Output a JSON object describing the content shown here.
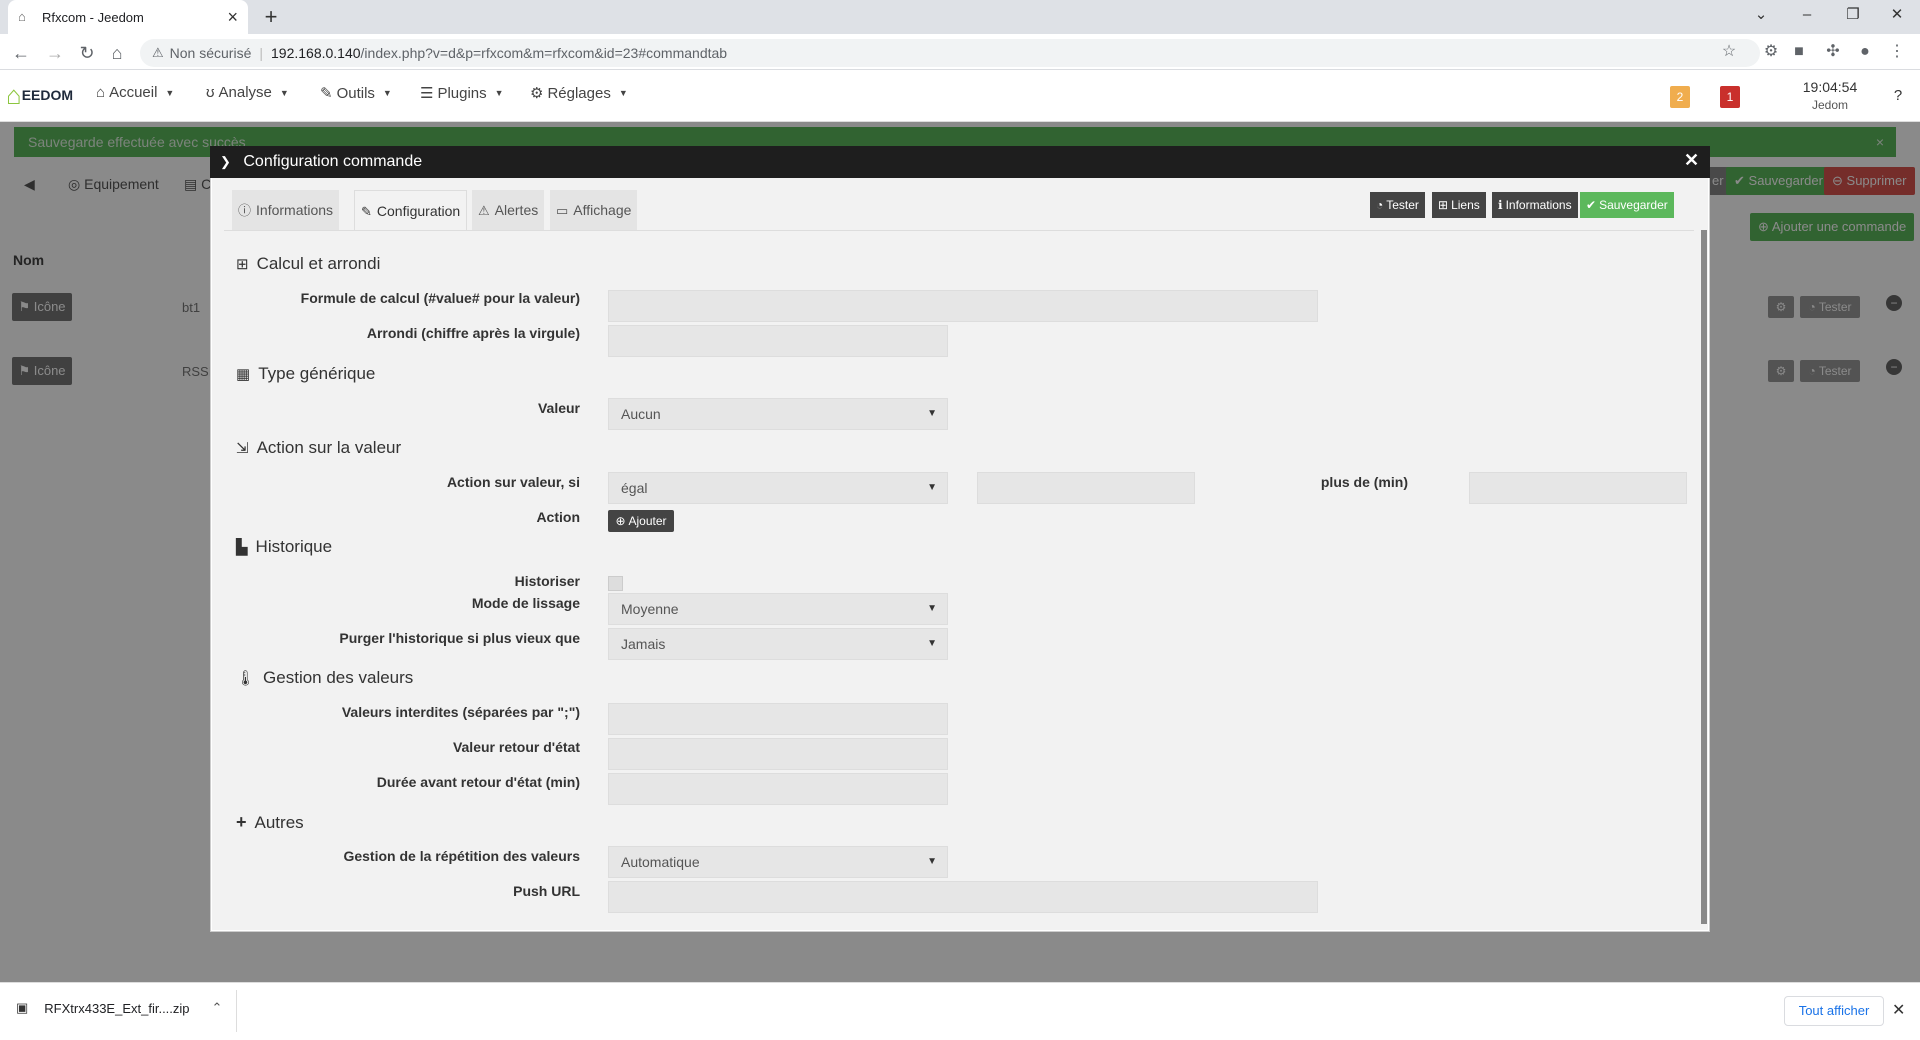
{
  "browser": {
    "tab_title": "Rfxcom - Jeedom",
    "security_label": "Non sécurisé",
    "url_host": "192.168.0.140",
    "url_path": "/index.php?v=d&p=rfxcom&m=rfxcom&id=23#commandtab"
  },
  "navbar": {
    "logo_text": "EEDOM",
    "menu": [
      "Accueil",
      "Analyse",
      "Outils",
      "Plugins",
      "Réglages"
    ],
    "badge_warning": "2",
    "badge_danger": "1",
    "clock_time": "19:04:54",
    "clock_user": "Jedom",
    "colors": {
      "warning": "#f0ad4e",
      "danger": "#c9302c"
    }
  },
  "page": {
    "alert_text": "Sauvegarde effectuée avec succès",
    "tabs": [
      "Equipement",
      "C"
    ],
    "btn_sauvegarder": "Sauvegarder",
    "btn_supprimer": "Supprimer",
    "btn_partial": "er",
    "btn_ajouter_commande": "Ajouter une commande",
    "nom_header": "Nom",
    "rows": [
      {
        "icone": "Icône",
        "name": "bt1",
        "tester": "Tester"
      },
      {
        "icone": "Icône",
        "name": "RSSI",
        "tester": "Tester"
      }
    ]
  },
  "modal": {
    "title": "Configuration commande",
    "tabs": [
      "Informations",
      "Configuration",
      "Alertes",
      "Affichage"
    ],
    "toolbar": {
      "tester": "Tester",
      "liens": "Liens",
      "informations": "Informations",
      "sauvegarder": "Sauvegarder"
    },
    "sections": {
      "calcul": {
        "title": "Calcul et arrondi",
        "formule_label": "Formule de calcul (#value# pour la valeur)",
        "arrondi_label": "Arrondi (chiffre après la virgule)"
      },
      "type": {
        "title": "Type générique",
        "valeur_label": "Valeur",
        "valeur_value": "Aucun"
      },
      "action": {
        "title": "Action sur la valeur",
        "si_label": "Action sur valeur, si",
        "si_value": "égal",
        "plus_de_label": "plus de (min)",
        "action_label": "Action",
        "ajouter": "Ajouter"
      },
      "historique": {
        "title": "Historique",
        "historiser_label": "Historiser",
        "lissage_label": "Mode de lissage",
        "lissage_value": "Moyenne",
        "purger_label": "Purger l'historique si plus vieux que",
        "purger_value": "Jamais"
      },
      "gestion": {
        "title": "Gestion des valeurs",
        "interdites_label": "Valeurs interdites (séparées par \";\")",
        "retour_label": "Valeur retour d'état",
        "duree_label": "Durée avant retour d'état (min)"
      },
      "autres": {
        "title": "Autres",
        "repetition_label": "Gestion de la répétition des valeurs",
        "repetition_value": "Automatique",
        "push_label": "Push URL"
      }
    }
  },
  "downloads": {
    "filename": "RFXtrx433E_Ext_fir....zip",
    "show_all": "Tout afficher"
  }
}
